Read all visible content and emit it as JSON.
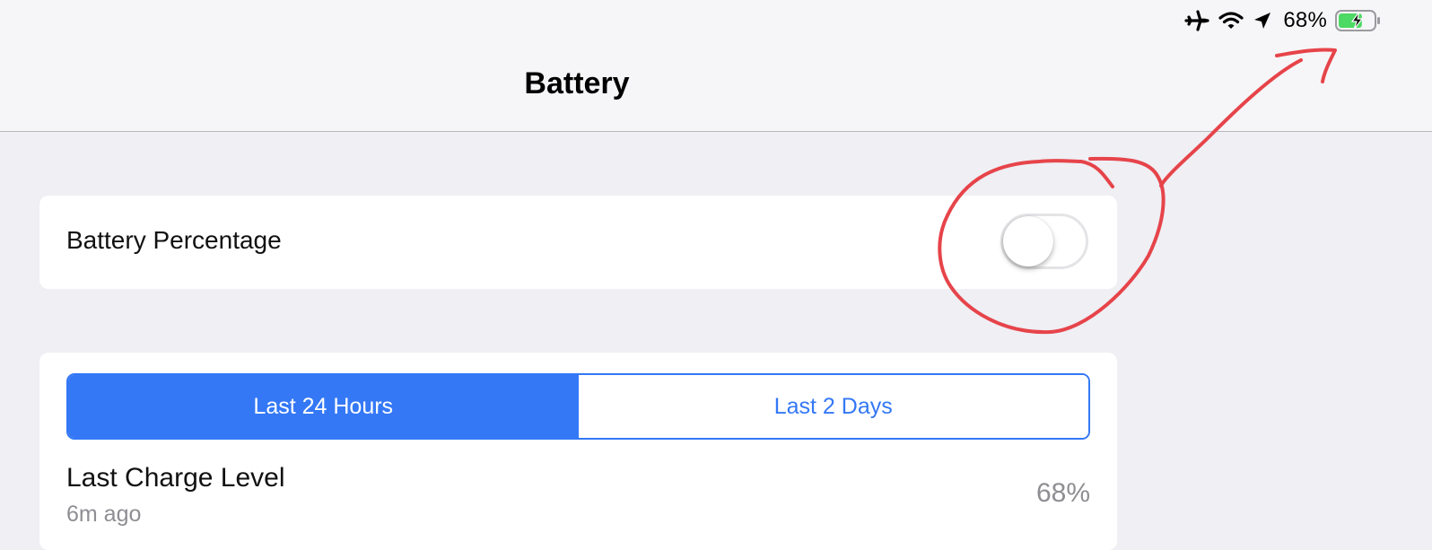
{
  "status_bar": {
    "icons": [
      "airplane-icon",
      "wifi-icon",
      "location-arrow-icon",
      "battery-charging-icon"
    ],
    "battery_text": "68%",
    "battery_fill_fraction": 0.68,
    "battery_fill_color": "#4cd964"
  },
  "nav": {
    "title": "Battery"
  },
  "toggle_row": {
    "label": "Battery Percentage",
    "toggle_on": false
  },
  "usage": {
    "segments": [
      {
        "label": "Last 24 Hours",
        "selected": true
      },
      {
        "label": "Last 2 Days",
        "selected": false
      }
    ],
    "last_charge": {
      "title": "Last Charge Level",
      "subtitle": "6m ago",
      "value": "68%"
    }
  },
  "colors": {
    "accent": "#3478f6",
    "annotation": "#e6444a",
    "background": "#efeff4"
  }
}
